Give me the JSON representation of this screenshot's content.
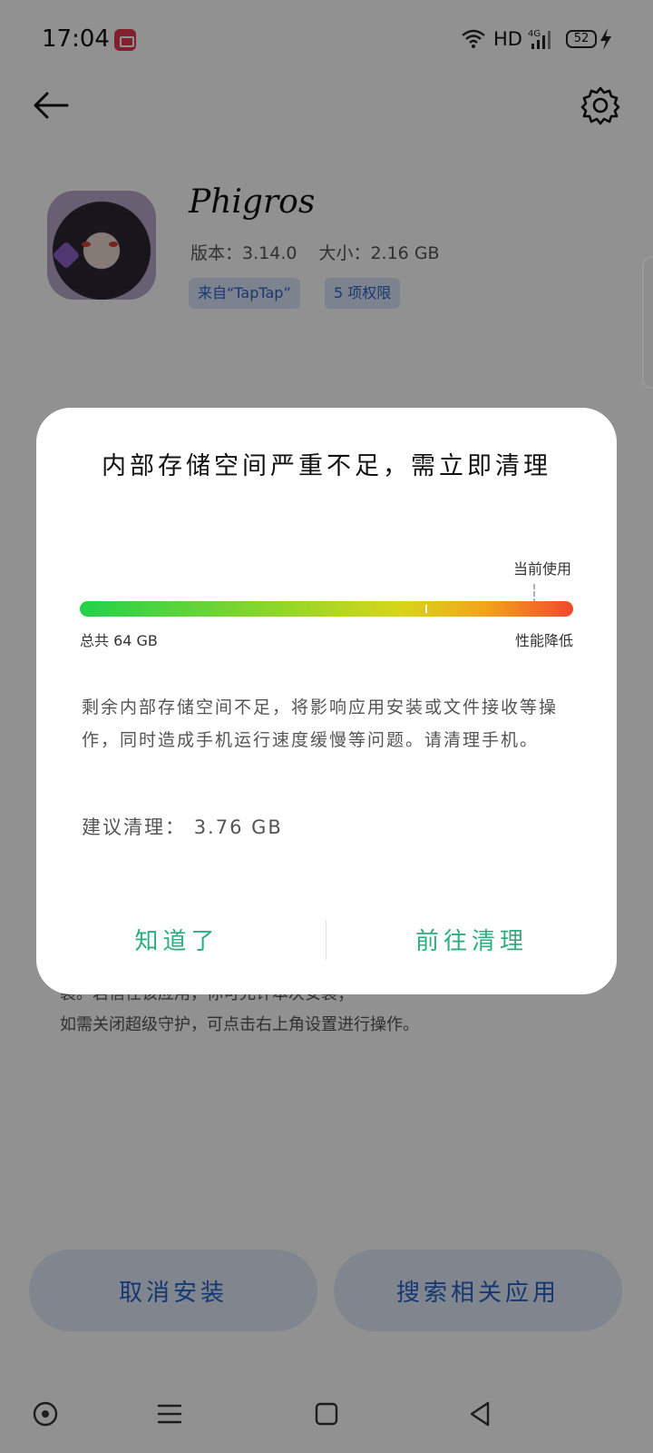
{
  "status_bar": {
    "time": "17:04",
    "network": "HD",
    "battery": "52"
  },
  "app": {
    "name": "Phigros",
    "version_label": "版本：",
    "version": "3.14.0",
    "size_label": "大小：",
    "size": "2.16 GB",
    "source_chip": "来自“TapTap”",
    "permissions_chip": "5 项权限"
  },
  "background_text": {
    "line1": "装。若信任该应用，你可允许本次安装；",
    "line2": "如需关闭超级守护，可点击右上角设置进行操作。"
  },
  "bottom_buttons": {
    "cancel": "取消安装",
    "search": "搜索相关应用"
  },
  "dialog": {
    "title": "内部存储空间严重不足，需立即清理",
    "current_usage_label": "当前使用",
    "total_label": "总共 64 GB",
    "performance_label": "性能降低",
    "description": "剩余内部存储空间不足，将影响应用安装或文件接收等操作，同时造成手机运行速度缓慢等问题。请清理手机。",
    "suggest_label": "建议清理：",
    "suggest_value": "3.76 GB",
    "ok_button": "知道了",
    "clean_button": "前往清理",
    "usage_fraction": 0.92,
    "threshold_fraction": 0.7
  },
  "colors": {
    "accent_green": "#2cae80",
    "link_blue": "#2563c9",
    "alert_red": "#e53950"
  },
  "icons": [
    "back-arrow-icon",
    "gear-icon",
    "wifi-icon",
    "signal-4g-icon",
    "battery-icon",
    "charging-bolt-icon",
    "screen-record-icon",
    "nav-home-dot-icon",
    "nav-menu-icon",
    "nav-square-icon",
    "nav-back-icon"
  ]
}
